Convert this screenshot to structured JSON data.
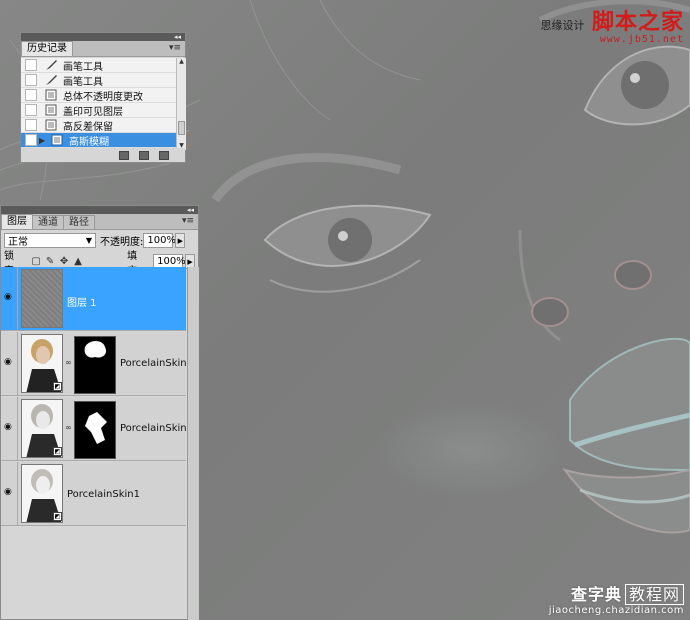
{
  "watermark_top": {
    "prefix": "思缘设计",
    "brand": "脚本之家",
    "url": "www.jb51.net"
  },
  "watermark_bottom": {
    "text": "查字典",
    "boxed": "教程网",
    "url": "jiaocheng.chazidian.com"
  },
  "history": {
    "tab": "历史记录",
    "items": [
      {
        "label": "画笔工具",
        "icon": "brush-icon"
      },
      {
        "label": "画笔工具",
        "icon": "brush-icon"
      },
      {
        "label": "总体不透明度更改",
        "icon": "history-state-icon"
      },
      {
        "label": "盖印可见图层",
        "icon": "history-state-icon"
      },
      {
        "label": "高反差保留",
        "icon": "history-state-icon"
      },
      {
        "label": "高斯模糊",
        "icon": "history-state-icon",
        "selected": true
      }
    ],
    "selected_color": "#3b8fe0"
  },
  "layers_panel": {
    "tabs": [
      "图层",
      "通道",
      "路径"
    ],
    "blend_mode": "正常",
    "opacity_label": "不透明度:",
    "opacity_value": "100%",
    "lock_label": "锁定:",
    "fill_label": "填充:",
    "fill_value": "100%",
    "selected_color": "#3aa3ff",
    "layers": [
      {
        "name": "图层 1",
        "selected": true,
        "mask": false
      },
      {
        "name": "PorcelainSkin...",
        "selected": false,
        "mask": true
      },
      {
        "name": "PorcelainSkin...",
        "selected": false,
        "mask": true
      },
      {
        "name": "PorcelainSkin1",
        "selected": false,
        "mask": false
      }
    ]
  }
}
